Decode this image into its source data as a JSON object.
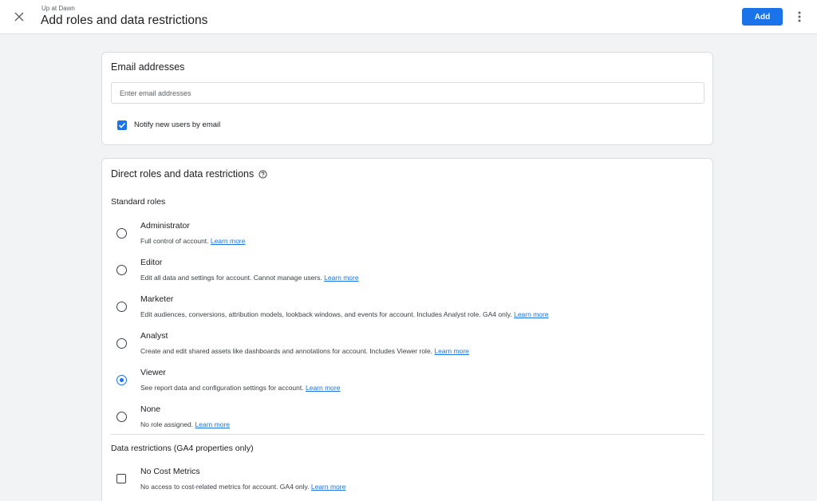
{
  "header": {
    "subtitle": "Up at Dawn",
    "title": "Add roles and data restrictions",
    "add_label": "Add"
  },
  "email_section": {
    "title": "Email addresses",
    "placeholder": "Enter email addresses",
    "value": "",
    "notify_label": "Notify new users by email",
    "notify_checked": true
  },
  "roles_section": {
    "title": "Direct roles and data restrictions",
    "standard_roles_label": "Standard roles",
    "learn_more": "Learn more",
    "roles": [
      {
        "name": "Administrator",
        "desc": "Full control of account.",
        "selected": false
      },
      {
        "name": "Editor",
        "desc": "Edit all data and settings for account. Cannot manage users.",
        "selected": false
      },
      {
        "name": "Marketer",
        "desc": "Edit audiences, conversions, attribution models, lookback windows, and events for account. Includes Analyst role. GA4 only.",
        "selected": false
      },
      {
        "name": "Analyst",
        "desc": "Create and edit shared assets like dashboards and annotations for account. Includes Viewer role.",
        "selected": false
      },
      {
        "name": "Viewer",
        "desc": "See report data and configuration settings for account.",
        "selected": true
      },
      {
        "name": "None",
        "desc": "No role assigned.",
        "selected": false
      }
    ],
    "data_restrictions_label": "Data restrictions (GA4 properties only)",
    "restrictions": [
      {
        "name": "No Cost Metrics",
        "desc": "No access to cost-related metrics for account. GA4 only.",
        "checked": false
      }
    ]
  },
  "colors": {
    "accent": "#1a73e8",
    "background": "#f1f3f4"
  }
}
